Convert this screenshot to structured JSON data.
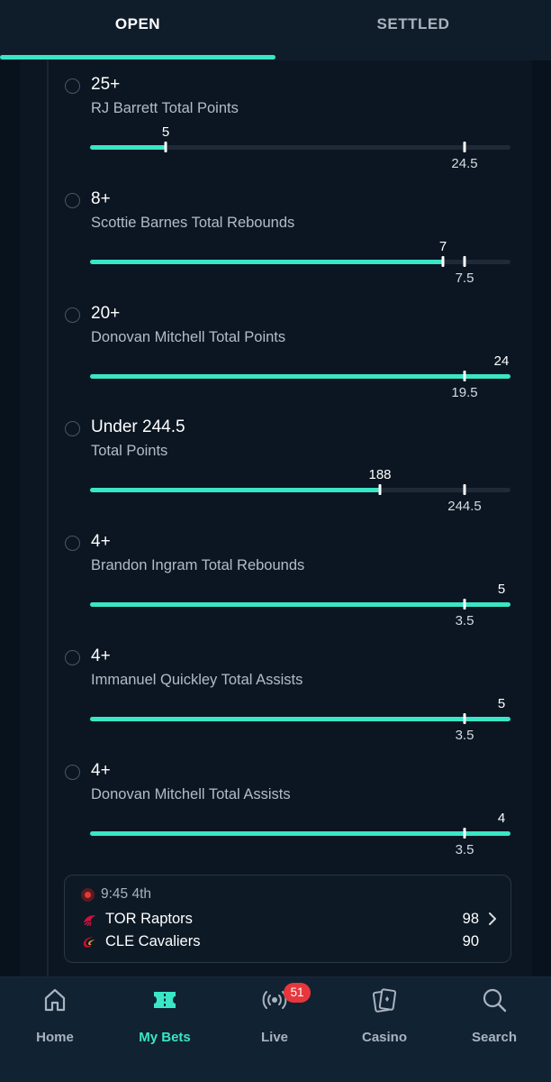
{
  "tabs": [
    {
      "label": "OPEN",
      "active": true
    },
    {
      "label": "SETTLED",
      "active": false
    }
  ],
  "legs": [
    {
      "pick": "25+",
      "market": "RJ Barrett Total Points",
      "current": "5",
      "target": "24.5",
      "progress_fraction": 0.18,
      "target_fraction": 0.89
    },
    {
      "pick": "8+",
      "market": "Scottie Barnes Total Rebounds",
      "current": "7",
      "target": "7.5",
      "progress_fraction": 0.84,
      "target_fraction": 0.89
    },
    {
      "pick": "20+",
      "market": "Donovan Mitchell Total Points",
      "current": "24",
      "target": "19.5",
      "progress_fraction": 1.0,
      "target_fraction": 0.89
    },
    {
      "pick": "Under 244.5",
      "market": "Total Points",
      "current": "188",
      "target": "244.5",
      "progress_fraction": 0.69,
      "target_fraction": 0.89
    },
    {
      "pick": "4+",
      "market": "Brandon Ingram Total Rebounds",
      "current": "5",
      "target": "3.5",
      "progress_fraction": 1.0,
      "target_fraction": 0.89
    },
    {
      "pick": "4+",
      "market": "Immanuel Quickley Total Assists",
      "current": "5",
      "target": "3.5",
      "progress_fraction": 1.0,
      "target_fraction": 0.89
    },
    {
      "pick": "4+",
      "market": "Donovan Mitchell Total Assists",
      "current": "4",
      "target": "3.5",
      "progress_fraction": 1.0,
      "target_fraction": 0.89
    }
  ],
  "game": {
    "clock": "9:45 4th",
    "teams": [
      {
        "name": "TOR Raptors",
        "score": "98",
        "icon": "raptors-logo-icon",
        "color": "#ce1141"
      },
      {
        "name": "CLE Cavaliers",
        "score": "90",
        "icon": "cavaliers-logo-icon",
        "color": "#c8102e"
      }
    ]
  },
  "nav": {
    "items": [
      {
        "label": "Home",
        "icon": "home-icon",
        "active": false
      },
      {
        "label": "My Bets",
        "icon": "ticket-icon",
        "active": true
      },
      {
        "label": "Live",
        "icon": "broadcast-icon",
        "active": false,
        "badge": "51"
      },
      {
        "label": "Casino",
        "icon": "cards-icon",
        "active": false
      },
      {
        "label": "Search",
        "icon": "search-icon",
        "active": false
      }
    ]
  },
  "colors": {
    "accent": "#39e6c5",
    "background": "#0b1622",
    "badge": "#e6373c"
  }
}
